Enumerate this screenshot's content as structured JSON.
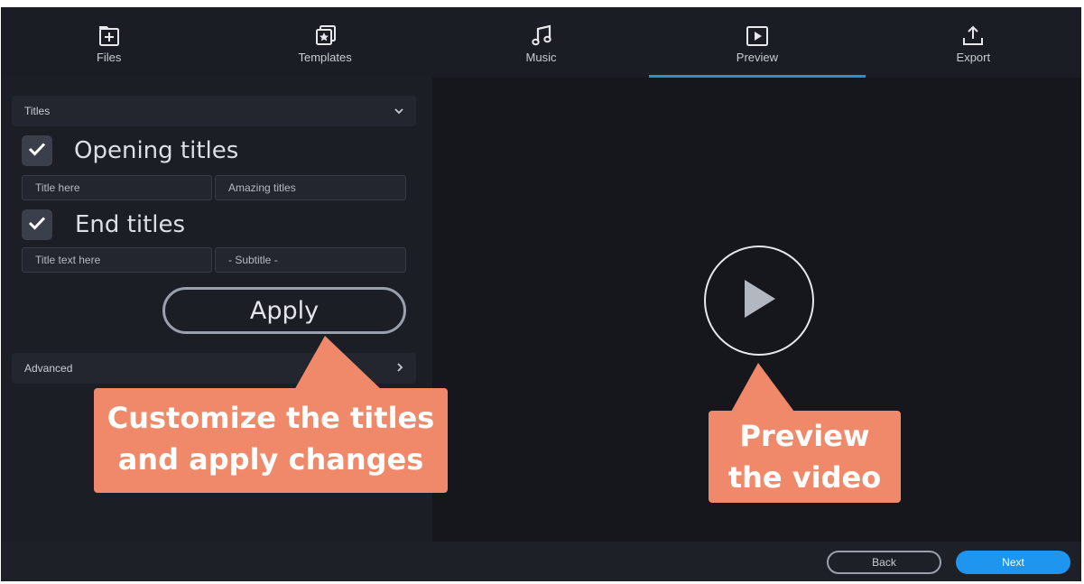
{
  "nav": {
    "tabs": [
      {
        "label": "Files",
        "icon": "files-icon"
      },
      {
        "label": "Templates",
        "icon": "templates-icon"
      },
      {
        "label": "Music",
        "icon": "music-icon"
      },
      {
        "label": "Preview",
        "icon": "preview-icon",
        "active": true
      },
      {
        "label": "Export",
        "icon": "export-icon"
      }
    ],
    "active_color": "#2a8fd6"
  },
  "titles_section": {
    "header": "Titles",
    "opening": {
      "label": "Opening titles",
      "checked": true,
      "field1": "Title here",
      "field2": "Amazing titles"
    },
    "ending": {
      "label": "End titles",
      "checked": true,
      "field1": "Title text here",
      "field2": "- Subtitle -"
    },
    "apply_label": "Apply"
  },
  "advanced_section": {
    "header": "Advanced"
  },
  "callouts": {
    "customize_line1": "Customize the titles",
    "customize_line2": "and apply changes",
    "preview_line1": "Preview",
    "preview_line2": "the video",
    "color": "#f0896a"
  },
  "footer": {
    "back_label": "Back",
    "next_label": "Next",
    "next_color": "#1e96f0"
  }
}
